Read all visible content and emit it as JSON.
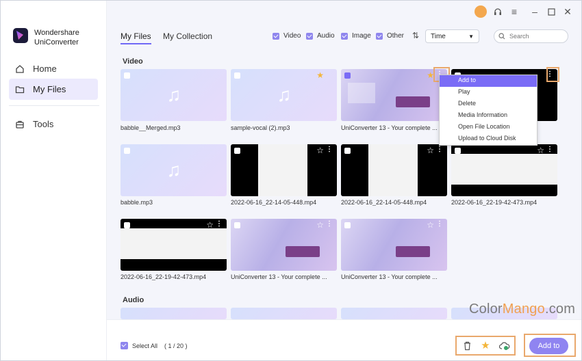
{
  "app": {
    "brand_line1": "Wondershare",
    "brand_line2": "UniConverter"
  },
  "sidebar": {
    "items": [
      {
        "label": "Home",
        "icon": "home-icon"
      },
      {
        "label": "My Files",
        "icon": "folder-icon"
      },
      {
        "label": "Tools",
        "icon": "toolbox-icon"
      }
    ]
  },
  "tabs": [
    "My Files",
    "My Collection"
  ],
  "filters": [
    "Video",
    "Audio",
    "Image",
    "Other"
  ],
  "sort": {
    "label": "Time"
  },
  "search": {
    "placeholder": "Search"
  },
  "sections": {
    "video": "Video",
    "audio": "Audio"
  },
  "files": {
    "row1": [
      "babble__Merged.mp3",
      "sample-vocal (2).mp3",
      "UniConverter 13 - Your complete ...",
      ""
    ],
    "row2": [
      "babble.mp3",
      "2022-06-16_22-14-05-448.mp4",
      "2022-06-16_22-14-05-448.mp4",
      "2022-06-16_22-19-42-473.mp4"
    ],
    "row3": [
      "2022-06-16_22-19-42-473.mp4",
      "UniConverter 13 - Your complete ...",
      "UniConverter 13 - Your complete ..."
    ]
  },
  "menu": [
    "Add to",
    "Play",
    "Delete",
    "Media Information",
    "Open File Location",
    "Upload to Cloud Disk"
  ],
  "bottom": {
    "select_all": "Select All",
    "page": "( 1 / 20 )",
    "add_to": "Add to"
  },
  "watermark": {
    "text_a": "Color",
    "text_b": "Mango",
    "text_c": ".com"
  },
  "colors": {
    "accent": "#8f84f1",
    "highlight": "#e9a86c",
    "menu_active": "#7a6cf6"
  }
}
